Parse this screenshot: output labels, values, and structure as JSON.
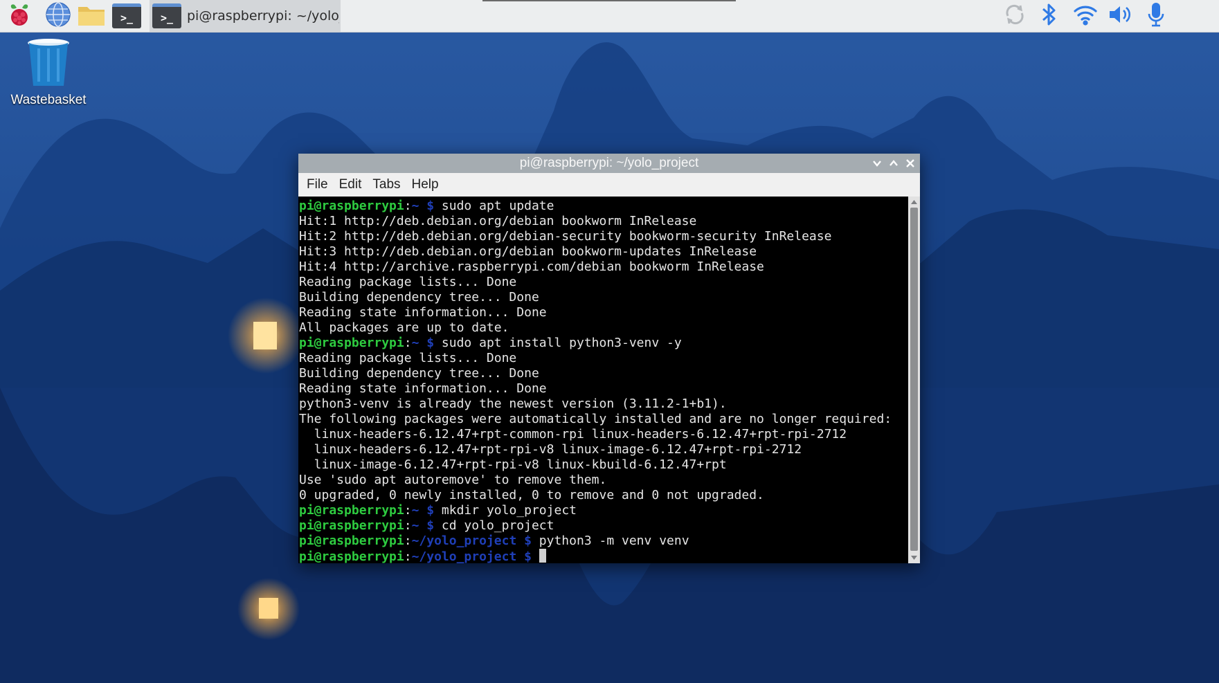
{
  "colors": {
    "taskbar_bg": "#eceeef",
    "prompt_user": "#2ecc40",
    "prompt_path": "#1f3fb8",
    "terminal_bg": "#000000",
    "title_bar": "#a5acb1"
  },
  "taskbar": {
    "launchers": [
      {
        "icon": "raspberry-menu-icon"
      },
      {
        "icon": "web-browser-icon"
      },
      {
        "icon": "file-manager-icon"
      },
      {
        "icon": "terminal-icon",
        "glyph": ">_"
      }
    ],
    "task": {
      "icon": "terminal-icon",
      "glyph": ">_",
      "label": "pi@raspberrypi: ~/yolo_..."
    },
    "tray": [
      "sync-icon",
      "bluetooth-icon",
      "wifi-icon",
      "volume-icon",
      "microphone-icon"
    ]
  },
  "desktop": {
    "wastebasket_label": "Wastebasket"
  },
  "window": {
    "title": "pi@raspberrypi: ~/yolo_project",
    "menu": [
      "File",
      "Edit",
      "Tabs",
      "Help"
    ]
  },
  "terminal": {
    "prompts": {
      "home": {
        "user": "pi@raspberrypi",
        "colon": ":",
        "path": "~ $ "
      },
      "yolo": {
        "user": "pi@raspberrypi",
        "colon": ":",
        "path": "~/yolo_project $ "
      }
    },
    "lines": [
      {
        "prompt": "home",
        "text": "sudo apt update"
      },
      {
        "text": "Hit:1 http://deb.debian.org/debian bookworm InRelease"
      },
      {
        "text": "Hit:2 http://deb.debian.org/debian-security bookworm-security InRelease"
      },
      {
        "text": "Hit:3 http://deb.debian.org/debian bookworm-updates InRelease"
      },
      {
        "text": "Hit:4 http://archive.raspberrypi.com/debian bookworm InRelease"
      },
      {
        "text": "Reading package lists... Done"
      },
      {
        "text": "Building dependency tree... Done"
      },
      {
        "text": "Reading state information... Done"
      },
      {
        "text": "All packages are up to date."
      },
      {
        "prompt": "home",
        "text": "sudo apt install python3-venv -y"
      },
      {
        "text": "Reading package lists... Done"
      },
      {
        "text": "Building dependency tree... Done"
      },
      {
        "text": "Reading state information... Done"
      },
      {
        "text": "python3-venv is already the newest version (3.11.2-1+b1)."
      },
      {
        "text": "The following packages were automatically installed and are no longer required:"
      },
      {
        "text": "  linux-headers-6.12.47+rpt-common-rpi linux-headers-6.12.47+rpt-rpi-2712"
      },
      {
        "text": "  linux-headers-6.12.47+rpt-rpi-v8 linux-image-6.12.47+rpt-rpi-2712"
      },
      {
        "text": "  linux-image-6.12.47+rpt-rpi-v8 linux-kbuild-6.12.47+rpt"
      },
      {
        "text": "Use 'sudo apt autoremove' to remove them."
      },
      {
        "text": "0 upgraded, 0 newly installed, 0 to remove and 0 not upgraded."
      },
      {
        "prompt": "home",
        "text": "mkdir yolo_project"
      },
      {
        "prompt": "home",
        "text": "cd yolo_project"
      },
      {
        "prompt": "yolo",
        "text": "python3 -m venv venv"
      },
      {
        "prompt": "yolo",
        "text": "",
        "cursor": true
      }
    ]
  }
}
